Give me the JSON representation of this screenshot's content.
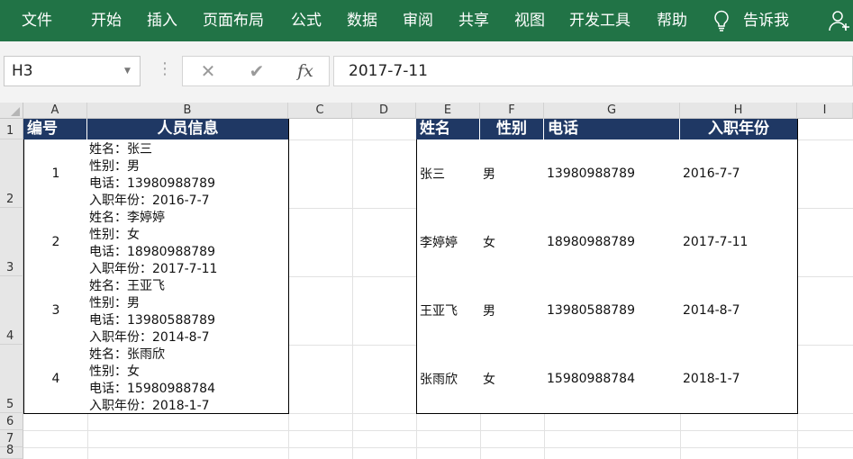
{
  "ribbon": {
    "menu": [
      "文件",
      "开始",
      "插入",
      "页面布局",
      "公式",
      "数据",
      "审阅",
      "共享",
      "视图",
      "开发工具",
      "帮助"
    ],
    "tell_me": "告诉我",
    "accent": "#217346"
  },
  "formula_bar": {
    "name_box": "H3",
    "cancel_icon": "✕",
    "enter_icon": "✔",
    "fx_label": "fx",
    "content": "2017-7-11"
  },
  "sheet": {
    "columns": [
      "A",
      "B",
      "C",
      "D",
      "E",
      "F",
      "G",
      "H",
      "I"
    ],
    "rows": [
      "1",
      "2",
      "3",
      "4",
      "5",
      "6",
      "7",
      "8"
    ],
    "header_fill": "#1f3864",
    "table_left": {
      "headers": [
        "编号",
        "人员信息"
      ],
      "rows": [
        {
          "no": "1",
          "info": [
            "姓名：张三",
            "性别：男",
            "电话：13980988789",
            "入职年份：2016-7-7"
          ]
        },
        {
          "no": "2",
          "info": [
            "姓名：李婷婷",
            "性别：女",
            "电话：18980988789",
            "入职年份：2017-7-11"
          ]
        },
        {
          "no": "3",
          "info": [
            "姓名：王亚飞",
            "性别：男",
            "电话：13980588789",
            "入职年份：2014-8-7"
          ]
        },
        {
          "no": "4",
          "info": [
            "姓名：张雨欣",
            "性别：女",
            "电话：15980988784",
            "入职年份：2018-1-7"
          ]
        }
      ]
    },
    "table_right": {
      "headers": [
        "姓名",
        "性别",
        "电话",
        "入职年份"
      ],
      "rows": [
        [
          "张三",
          "男",
          "13980988789",
          "2016-7-7"
        ],
        [
          "李婷婷",
          "女",
          "18980988789",
          "2017-7-11"
        ],
        [
          "王亚飞",
          "男",
          "13980588789",
          "2014-8-7"
        ],
        [
          "张雨欣",
          "女",
          "15980988784",
          "2018-1-7"
        ]
      ]
    }
  }
}
